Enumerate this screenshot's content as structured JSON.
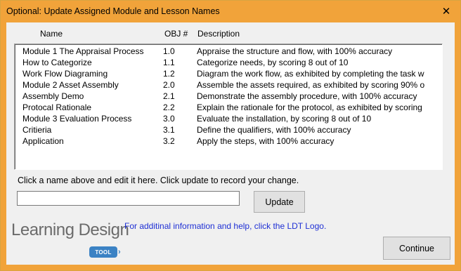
{
  "window": {
    "title": "Optional: Update Assigned Module and Lesson Names",
    "close_glyph": "✕"
  },
  "columns": {
    "name": "Name",
    "obj": "OBJ #",
    "description": "Description"
  },
  "rows": [
    {
      "name": "Module 1 The Appraisal Process",
      "obj": "1.0",
      "description": "Appraise the structure and flow, with 100% accuracy"
    },
    {
      "name": "How to Categorize",
      "obj": "1.1",
      "description": "Categorize needs, by scoring 8 out of 10"
    },
    {
      "name": "Work Flow Diagraming",
      "obj": "1.2",
      "description": "Diagram the work flow, as exhibited by completing the task w"
    },
    {
      "name": "Module 2 Asset Assembly",
      "obj": "2.0",
      "description": "Assemble the assets required, as exhibited by scoring 90% o"
    },
    {
      "name": "Assembly Demo",
      "obj": "2.1",
      "description": "Demonstrate the assembly procedure, with 100% accuracy"
    },
    {
      "name": "Protocal Rationale",
      "obj": "2.2",
      "description": "Explain the rationale for the protocol, as exhibited by scoring"
    },
    {
      "name": "Module 3 Evaluation Process",
      "obj": "3.0",
      "description": "Evaluate the installation, by scoring 8 out of 10"
    },
    {
      "name": "Critieria",
      "obj": "3.1",
      "description": "Define the qualifiers, with 100% accuracy"
    },
    {
      "name": "Application",
      "obj": "3.2",
      "description": "Apply the steps, with 100% accuracy"
    }
  ],
  "instruction": "Click a name above and edit it here. Click update to record your change.",
  "edit_field": {
    "value": "",
    "placeholder": ""
  },
  "buttons": {
    "update": "Update",
    "continue": "Continue"
  },
  "logo": {
    "text": "Learning Design",
    "badge": "TOOL"
  },
  "help_text": "For additinal information and help, click the LDT Logo.",
  "colors": {
    "titlebar": "#f1a33a",
    "help_link": "#1e2fd4",
    "logo_badge": "#3b82c4"
  }
}
